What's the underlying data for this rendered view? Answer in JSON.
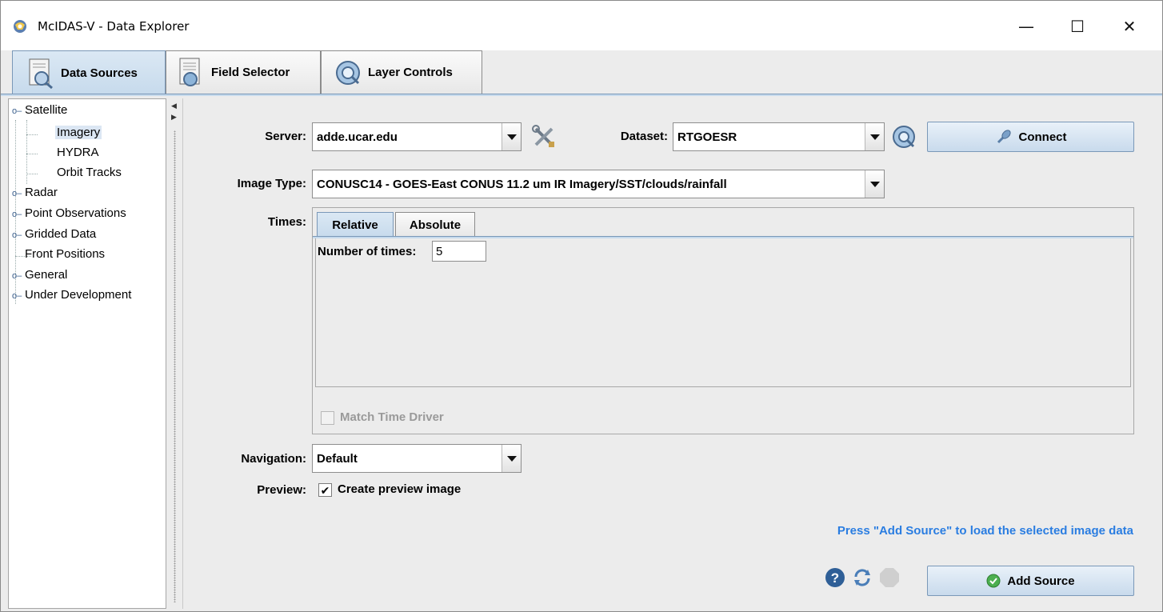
{
  "window": {
    "title": "McIDAS-V - Data Explorer",
    "minimize_glyph": "—",
    "maximize_glyph": "☐",
    "close_glyph": "✕"
  },
  "tabs": [
    {
      "label": "Data Sources",
      "icon": "magnifier-page-icon",
      "active": true
    },
    {
      "label": "Field Selector",
      "icon": "field-selector-icon",
      "active": false
    },
    {
      "label": "Layer Controls",
      "icon": "layer-controls-icon",
      "active": false
    }
  ],
  "tree": {
    "items": [
      {
        "label": "Satellite",
        "expandable": true,
        "expanded": true
      },
      {
        "label": "Imagery",
        "selected": true
      },
      {
        "label": "HYDRA"
      },
      {
        "label": "Orbit Tracks"
      },
      {
        "label": "Radar",
        "expandable": true
      },
      {
        "label": "Point Observations",
        "expandable": true
      },
      {
        "label": "Gridded Data",
        "expandable": true
      },
      {
        "label": "Front Positions"
      },
      {
        "label": "General",
        "expandable": true
      },
      {
        "label": "Under Development",
        "expandable": true
      }
    ]
  },
  "form": {
    "server_label": "Server:",
    "server_value": "adde.ucar.edu",
    "dataset_label": "Dataset:",
    "dataset_value": "RTGOESR",
    "connect_label": "Connect",
    "image_type_label": "Image Type:",
    "image_type_value": "CONUSC14 - GOES-East CONUS 11.2 um IR Imagery/SST/clouds/rainfall",
    "times_label": "Times:",
    "times_tabs": {
      "relative": "Relative",
      "absolute": "Absolute"
    },
    "number_of_times_label": "Number of times:",
    "number_of_times_value": "5",
    "match_time_driver_label": "Match Time Driver",
    "match_time_driver_checked": false,
    "navigation_label": "Navigation:",
    "navigation_value": "Default",
    "preview_label": "Preview:",
    "create_preview_label": "Create preview image",
    "create_preview_checked": true
  },
  "footer": {
    "hint": "Press \"Add Source\" to load the selected image data",
    "add_source_label": "Add Source"
  },
  "colors": {
    "accent": "#c6daec",
    "hint_text": "#2a7de1",
    "tab_border": "#7a98b8"
  }
}
